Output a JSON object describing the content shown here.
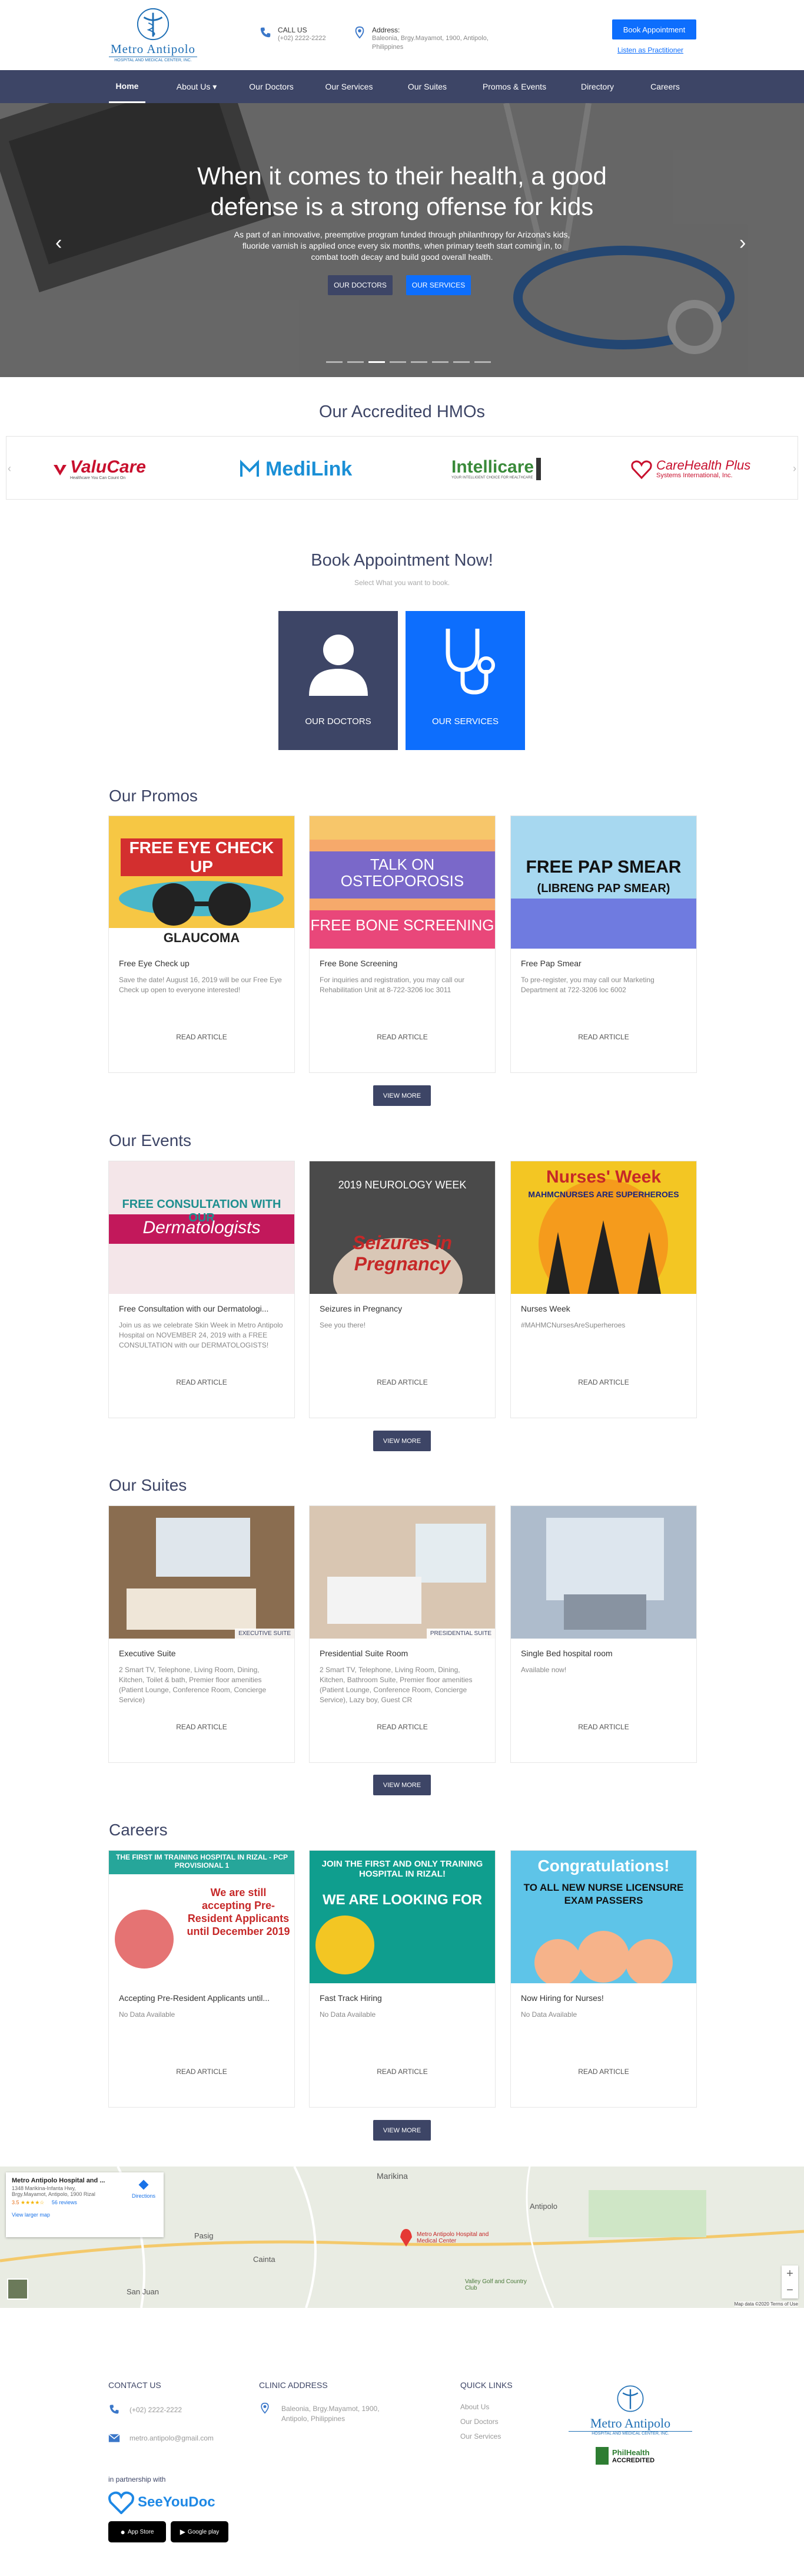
{
  "brand": {
    "name": "Metro Antipolo",
    "tagline": "HOSPITAL AND MEDICAL CENTER, INC."
  },
  "topbar": {
    "call_label": "CALL US",
    "call_value": "(+02) 2222-2222",
    "address_label": "Address:",
    "address_value": "Baleonia, Brgy.Mayamot, 1900, Antipolo, Philippines",
    "book_button": "Book Appointment",
    "practitioner_link": "Listen as Practitioner"
  },
  "nav": [
    "Home",
    "About Us ▾",
    "Our Doctors",
    "Our Services",
    "Our Suites",
    "Promos & Events",
    "Directory",
    "Careers"
  ],
  "hero": {
    "title_line1": "When it comes to their health, a good",
    "title_line2": "defense is a strong offense for kids",
    "text": "As part of an innovative, preemptive program funded through philanthropy for Arizona's kids, fluoride varnish is applied once every six months, when primary teeth start coming in, to combat tooth decay and build good overall health.",
    "btn_doctors": "OUR DOCTORS",
    "btn_services": "OUR SERVICES",
    "prev": "‹",
    "next": "›"
  },
  "hmo": {
    "title": "Our Accredited HMOs",
    "logos": [
      {
        "name": "ValuCare",
        "sub": "Healthcare You Can Count On",
        "color": "#c8102e"
      },
      {
        "name": "MediLink",
        "sub": "MediLink",
        "color": "#1a8fd6"
      },
      {
        "name": "Intellicare",
        "sub": "YOUR INTELLIGENT CHOICE FOR HEALTHCARE",
        "color": "#3a8a3a"
      },
      {
        "name": "CareHealth Plus",
        "sub": "Systems International, Inc.",
        "color": "#c8102e"
      }
    ]
  },
  "book": {
    "title": "Book Appointment Now!",
    "subtitle": "Select What you want to book.",
    "doctors": "OUR DOCTORS",
    "services": "OUR SERVICES"
  },
  "promos": {
    "title": "Our Promos",
    "view_more": "VIEW MORE",
    "items": [
      {
        "title": "Free Eye Check up",
        "desc": "Save the date! August 16, 2019 will be our Free Eye Check up open to everyone interested!",
        "read": "READ ARTICLE",
        "poster_top": "FREE EYE CHECK UP",
        "poster_bottom": "GLAUCOMA"
      },
      {
        "title": "Free Bone Screening",
        "desc": "For inquiries and registration, you may call our Rehabilitation Unit at 8-722-3206 loc 3011",
        "read": "READ ARTICLE",
        "poster_top": "TALK ON OSTEOPOROSIS",
        "poster_bottom": "FREE BONE SCREENING"
      },
      {
        "title": "Free Pap Smear",
        "desc": "To pre-register, you may call our Marketing Department at 722-3206 loc 6002",
        "read": "READ ARTICLE",
        "poster_top": "FREE PAP SMEAR",
        "poster_bottom": "(LIBRENG PAP SMEAR)"
      }
    ]
  },
  "events": {
    "title": "Our Events",
    "view_more": "VIEW MORE",
    "items": [
      {
        "title": "Free Consultation with our Dermatologi...",
        "desc": "Join us as we celebrate Skin Week in Metro Antipolo Hospital on NOVEMBER 24, 2019 with a FREE CONSULTATION with our DERMATOLOGISTS!",
        "read": "READ ARTICLE",
        "poster_top": "FREE CONSULTATION WITH OUR",
        "poster_bottom": "Dermatologists"
      },
      {
        "title": "Seizures in Pregnancy",
        "desc": "See you there!",
        "read": "READ ARTICLE",
        "poster_top": "2019 NEUROLOGY WEEK",
        "poster_bottom": "Seizures in Pregnancy"
      },
      {
        "title": "Nurses Week",
        "desc": "#MAHMCNursesAreSuperheroes",
        "read": "READ ARTICLE",
        "poster_top": "Nurses' Week",
        "poster_bottom": "MAHMCNURSES ARE SUPERHEROES"
      }
    ]
  },
  "suites": {
    "title": "Our Suites",
    "view_more": "VIEW MORE",
    "items": [
      {
        "title": "Executive Suite",
        "desc": "2 Smart TV, Telephone, Living Room, Dining, Kitchen, Toilet & bath, Premier floor amenities (Patient Lounge, Conference Room, Concierge Service)",
        "read": "READ ARTICLE",
        "badge": "EXECUTIVE SUITE"
      },
      {
        "title": "Presidential Suite Room",
        "desc": "2 Smart TV, Telephone, Living Room, Dining, Kitchen, Bathroom Suite, Premier floor amenities (Patient Lounge, Conference Room, Concierge Service), Lazy boy, Guest CR",
        "read": "READ ARTICLE",
        "badge": "PRESIDENTIAL SUITE"
      },
      {
        "title": "Single Bed hospital room",
        "desc": "Available now!",
        "read": "READ ARTICLE",
        "badge": ""
      }
    ]
  },
  "careers": {
    "title": "Careers",
    "view_more": "VIEW MORE",
    "items": [
      {
        "title": "Accepting Pre-Resident Applicants until...",
        "desc": "No Data Available",
        "read": "READ ARTICLE",
        "poster_top": "THE FIRST IM TRAINING HOSPITAL IN RIZAL - PCP PROVISIONAL 1",
        "poster_bottom": "We are still accepting Pre-Resident Applicants until December 2019"
      },
      {
        "title": "Fast Track Hiring",
        "desc": "No Data Available",
        "read": "READ ARTICLE",
        "poster_top": "JOIN THE FIRST AND ONLY TRAINING HOSPITAL IN RIZAL!",
        "poster_bottom": "WE ARE LOOKING FOR"
      },
      {
        "title": "Now Hiring for Nurses!",
        "desc": "No Data Available",
        "read": "READ ARTICLE",
        "poster_top": "Congratulations!",
        "poster_bottom": "TO ALL NEW NURSE LICENSURE EXAM PASSERS"
      }
    ]
  },
  "map": {
    "place_name": "Metro Antipolo Hospital and ...",
    "place_addr": "1348 Marikina-Infanta Hwy, Brgy.Mayamot, Antipolo, 1900 Rizal",
    "rating": "3.5",
    "reviews": "56 reviews",
    "directions": "Directions",
    "larger": "View larger map",
    "marker_label": "Metro Antipolo Hospital and Medical Center",
    "labels": [
      "Marikina",
      "Cainta",
      "San Juan",
      "Antipolo",
      "Valley Golf and Country Club",
      "Pasig"
    ],
    "footer_note": "Map data ©2020   Terms of Use"
  },
  "footer": {
    "contact_title": "CONTACT US",
    "phone": "(+02) 2222-2222",
    "email": "metro.antipolo@gmail.com",
    "clinic_title": "CLINIC ADDRESS",
    "clinic_addr": "Baleonia, Brgy.Mayamot, 1900, Antipolo, Philippines",
    "quick_title": "QUICK LINKS",
    "quick_links": [
      "About Us",
      "Our Doctors",
      "Our Services"
    ],
    "partner_label": "in partnership with",
    "partner_name": "SeeYouDoc",
    "appstore": "App Store",
    "googleplay": "Google play",
    "philhealth": "PhilHealth",
    "accredited": "ACCREDITED"
  },
  "colors": {
    "navy": "#3d4566",
    "blue": "#0d6efd",
    "link": "#1f6fb5"
  }
}
